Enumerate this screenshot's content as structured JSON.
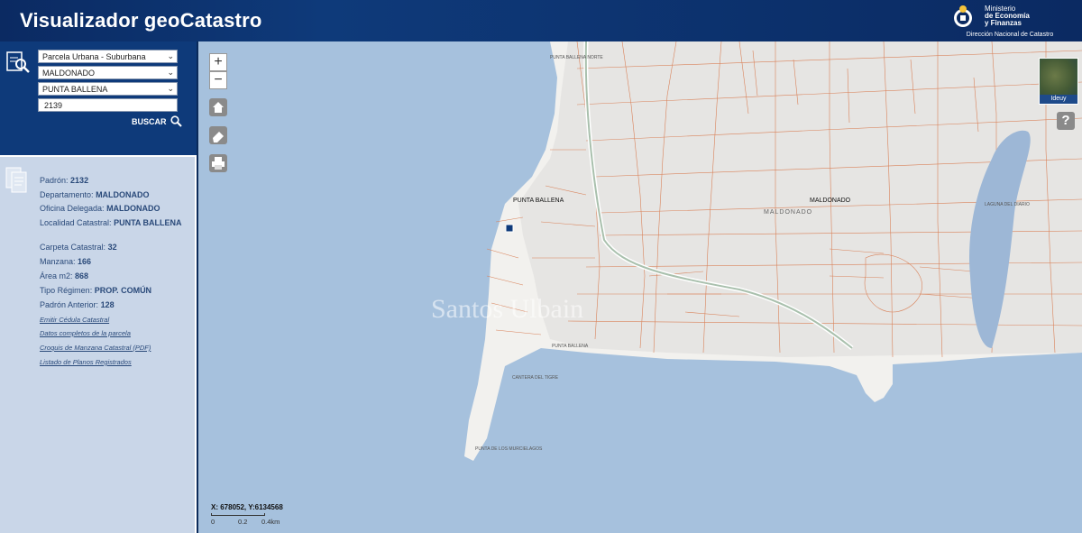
{
  "header": {
    "title": "Visualizador geoCatastro",
    "ministry_line1": "Ministerio",
    "ministry_line2": "de Economía",
    "ministry_line3": "y Finanzas",
    "ministry_sub": "Dirección Nacional de Catastro"
  },
  "search": {
    "type_select": "Parcela Urbana - Suburbana",
    "department_select": "MALDONADO",
    "locality_select": "PUNTA BALLENA",
    "parcel_value": "2139",
    "button_label": "BUSCAR"
  },
  "info": {
    "padron_label": "Padrón:",
    "padron": "2132",
    "departamento_label": "Departamento:",
    "departamento": "MALDONADO",
    "oficina_label": "Oficina Delegada:",
    "oficina": "MALDONADO",
    "localidad_label": "Localidad Catastral:",
    "localidad": "PUNTA BALLENA",
    "carpeta_label": "Carpeta Catastral:",
    "carpeta": "32",
    "manzana_label": "Manzana:",
    "manzana": "166",
    "area_label": "Área m2:",
    "area": "868",
    "regimen_label": "Tipo Régimen:",
    "regimen": "PROP. COMÚN",
    "anterior_label": "Padrón Anterior:",
    "anterior": "128",
    "links": [
      "Emitir Cédula Catastral",
      "Datos completos de la parcela",
      "Croquis de Manzana Catastral (PDF)",
      "Listado de Planos Registrados"
    ]
  },
  "map": {
    "zoom_in": "+",
    "zoom_out": "−",
    "coords": "X: 678052, Y:6134568",
    "scale": [
      "0",
      "0.2",
      "0.4km"
    ],
    "overview_label": "Ideuy",
    "help": "?",
    "labels": {
      "punta_ballena_main": "PUNTA BALLENA",
      "maldonado_main": "MALDONADO",
      "maldonado_sub": "MALDONADO",
      "punta_ballena_south": "PUNTA BALLENA",
      "laguna": "LAGUNA DEL DIARIO",
      "punta_murcielagos": "PUNTA DE LOS MURCIELAGOS",
      "punta_ballena_north": "PUNTA BALLENA NORTE",
      "cantera": "CANTERA DEL TIGRE"
    },
    "watermark": "Santos Ulbain"
  }
}
